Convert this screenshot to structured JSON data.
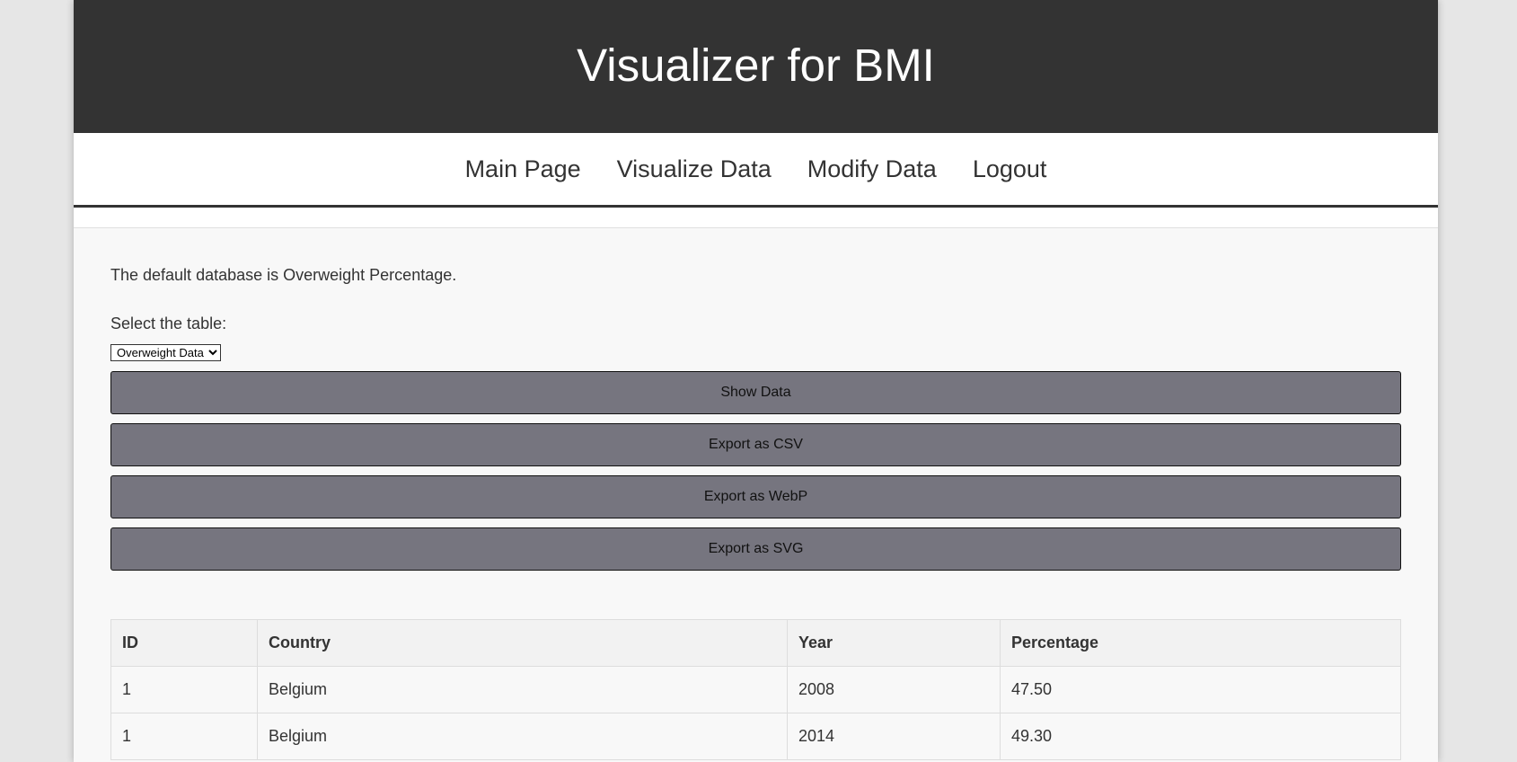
{
  "header": {
    "title": "Visualizer for BMI"
  },
  "nav": {
    "items": [
      {
        "label": "Main Page"
      },
      {
        "label": "Visualize Data"
      },
      {
        "label": "Modify Data"
      },
      {
        "label": "Logout"
      }
    ]
  },
  "main": {
    "intro": "The default database is Overweight Percentage.",
    "select_label": "Select the table:",
    "select_value": "Overweight Data",
    "buttons": {
      "show": "Show Data",
      "csv": "Export as CSV",
      "webp": "Export as WebP",
      "svg": "Export as SVG"
    },
    "table": {
      "headers": [
        "ID",
        "Country",
        "Year",
        "Percentage"
      ],
      "rows": [
        [
          "1",
          "Belgium",
          "2008",
          "47.50"
        ],
        [
          "1",
          "Belgium",
          "2014",
          "49.30"
        ]
      ]
    }
  },
  "colors": {
    "header_bg": "#333333",
    "button_bg": "#76757f",
    "page_bg": "#e6e6e6"
  }
}
